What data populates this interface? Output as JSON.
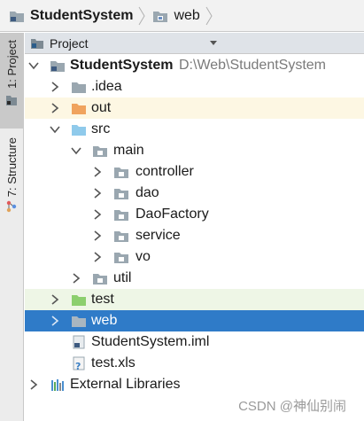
{
  "navbar": {
    "project_name": "StudentSystem",
    "current_folder": "web"
  },
  "tool_stripe": {
    "project_tab": "1: Project",
    "structure_tab": "7: Structure"
  },
  "panel": {
    "title": "Project"
  },
  "tree": {
    "root_name": "StudentSystem",
    "root_path": "D:\\Web\\StudentSystem",
    "idea": ".idea",
    "out": "out",
    "src": "src",
    "main": "main",
    "controller": "controller",
    "dao": "dao",
    "daofactory": "DaoFactory",
    "service": "service",
    "vo": "vo",
    "util": "util",
    "test": "test",
    "web": "web",
    "iml": "StudentSystem.iml",
    "xls": "test.xls",
    "external": "External Libraries"
  },
  "colors": {
    "selection": "#2f7bc8",
    "folder_default": "#9aa7b0",
    "folder_excluded": "#f0a35e",
    "folder_source": "#8fcaeb",
    "folder_test": "#8ccf6e"
  },
  "watermark": "CSDN @神仙别闹"
}
